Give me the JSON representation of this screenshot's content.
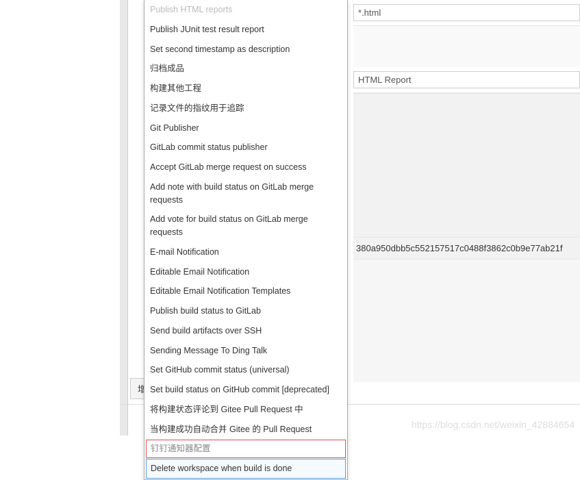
{
  "dropdown": {
    "items": [
      {
        "label": "Publish HTML reports",
        "disabled": true
      },
      {
        "label": "Publish JUnit test result report"
      },
      {
        "label": "Set second timestamp as description"
      },
      {
        "label": "归档成品"
      },
      {
        "label": "构建其他工程"
      },
      {
        "label": "记录文件的指纹用于追踪"
      },
      {
        "label": "Git Publisher"
      },
      {
        "label": "GitLab commit status publisher"
      },
      {
        "label": "Accept GitLab merge request on success"
      },
      {
        "label": "Add note with build status on GitLab merge requests"
      },
      {
        "label": "Add vote for build status on GitLab merge requests"
      },
      {
        "label": "E-mail Notification"
      },
      {
        "label": "Editable Email Notification"
      },
      {
        "label": "Editable Email Notification Templates"
      },
      {
        "label": "Publish build status to GitLab"
      },
      {
        "label": "Send build artifacts over SSH"
      },
      {
        "label": "Sending Message To Ding Talk"
      },
      {
        "label": "Set GitHub commit status (universal)"
      },
      {
        "label": "Set build status on GitHub commit [deprecated]"
      },
      {
        "label": "将构建状态评论到 Gitee Pull Request 中"
      },
      {
        "label": "当构建成功自动合并 Gitee 的 Pull Request"
      },
      {
        "label": "钉钉通知器配置",
        "red": true
      },
      {
        "label": "Delete workspace when build is done",
        "blue": true
      }
    ]
  },
  "form": {
    "field1": "*.html",
    "field2": "HTML Report",
    "hash": "380a950dbb5c552157517c0488f3862c0b9e77ab21f"
  },
  "buttons": {
    "add_post_build": "增加构建后操作步骤"
  },
  "watermark": "https://blog.csdn.net/weixin_42884654"
}
